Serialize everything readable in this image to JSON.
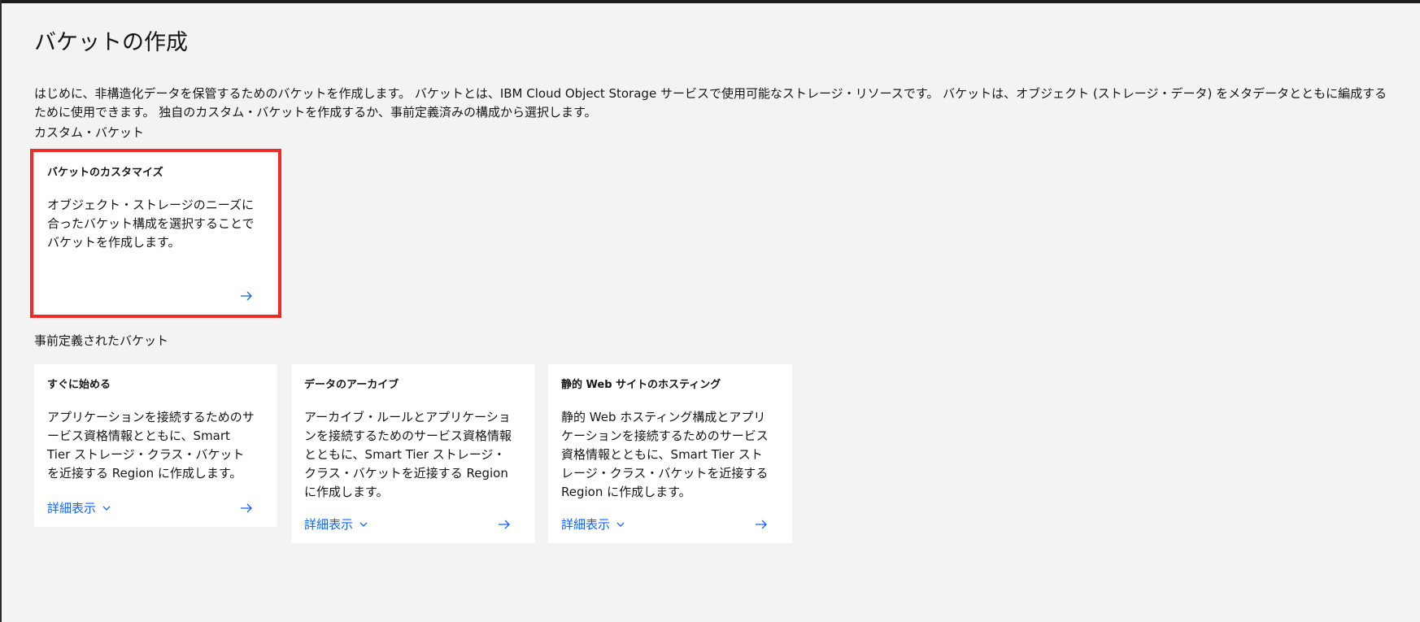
{
  "page": {
    "title": "バケットの作成",
    "intro": "はじめに、非構造化データを保管するためのバケットを作成します。 バケットとは、IBM Cloud Object Storage サービスで使用可能なストレージ・リソースです。 バケットは、オブジェクト (ストレージ・データ) をメタデータとともに編成するために使用できます。 独自のカスタム・バケットを作成するか、事前定義済みの構成から選択します。"
  },
  "custom_section": {
    "label": "カスタム・バケット",
    "tile": {
      "title": "バケットのカスタマイズ",
      "description": "オブジェクト・ストレージのニーズに合ったバケット構成を選択することでバケットを作成します。",
      "arrow_icon": "arrow-right-icon"
    }
  },
  "predefined_section": {
    "label": "事前定義されたバケット",
    "tiles": [
      {
        "title": "すぐに始める",
        "description": "アプリケーションを接続するためのサービス資格情報とともに、Smart Tier ストレージ・クラス・バケットを近接する Region に作成します。",
        "details_label": "詳細表示"
      },
      {
        "title": "データのアーカイブ",
        "description": "アーカイブ・ルールとアプリケーションを接続するためのサービス資格情報とともに、Smart Tier ストレージ・クラス・バケットを近接する Region に作成します。",
        "details_label": "詳細表示"
      },
      {
        "title": "静的 Web サイトのホスティング",
        "description": "静的 Web ホスティング構成とアプリケーションを接続するためのサービス資格情報とともに、Smart Tier ストレージ・クラス・バケットを近接する Region に作成します。",
        "details_label": "詳細表示"
      }
    ]
  },
  "colors": {
    "background": "#f3f3f3",
    "tile_background": "#ffffff",
    "link": "#0f62fe",
    "highlight": "#ee2b24",
    "text": "#161616"
  }
}
